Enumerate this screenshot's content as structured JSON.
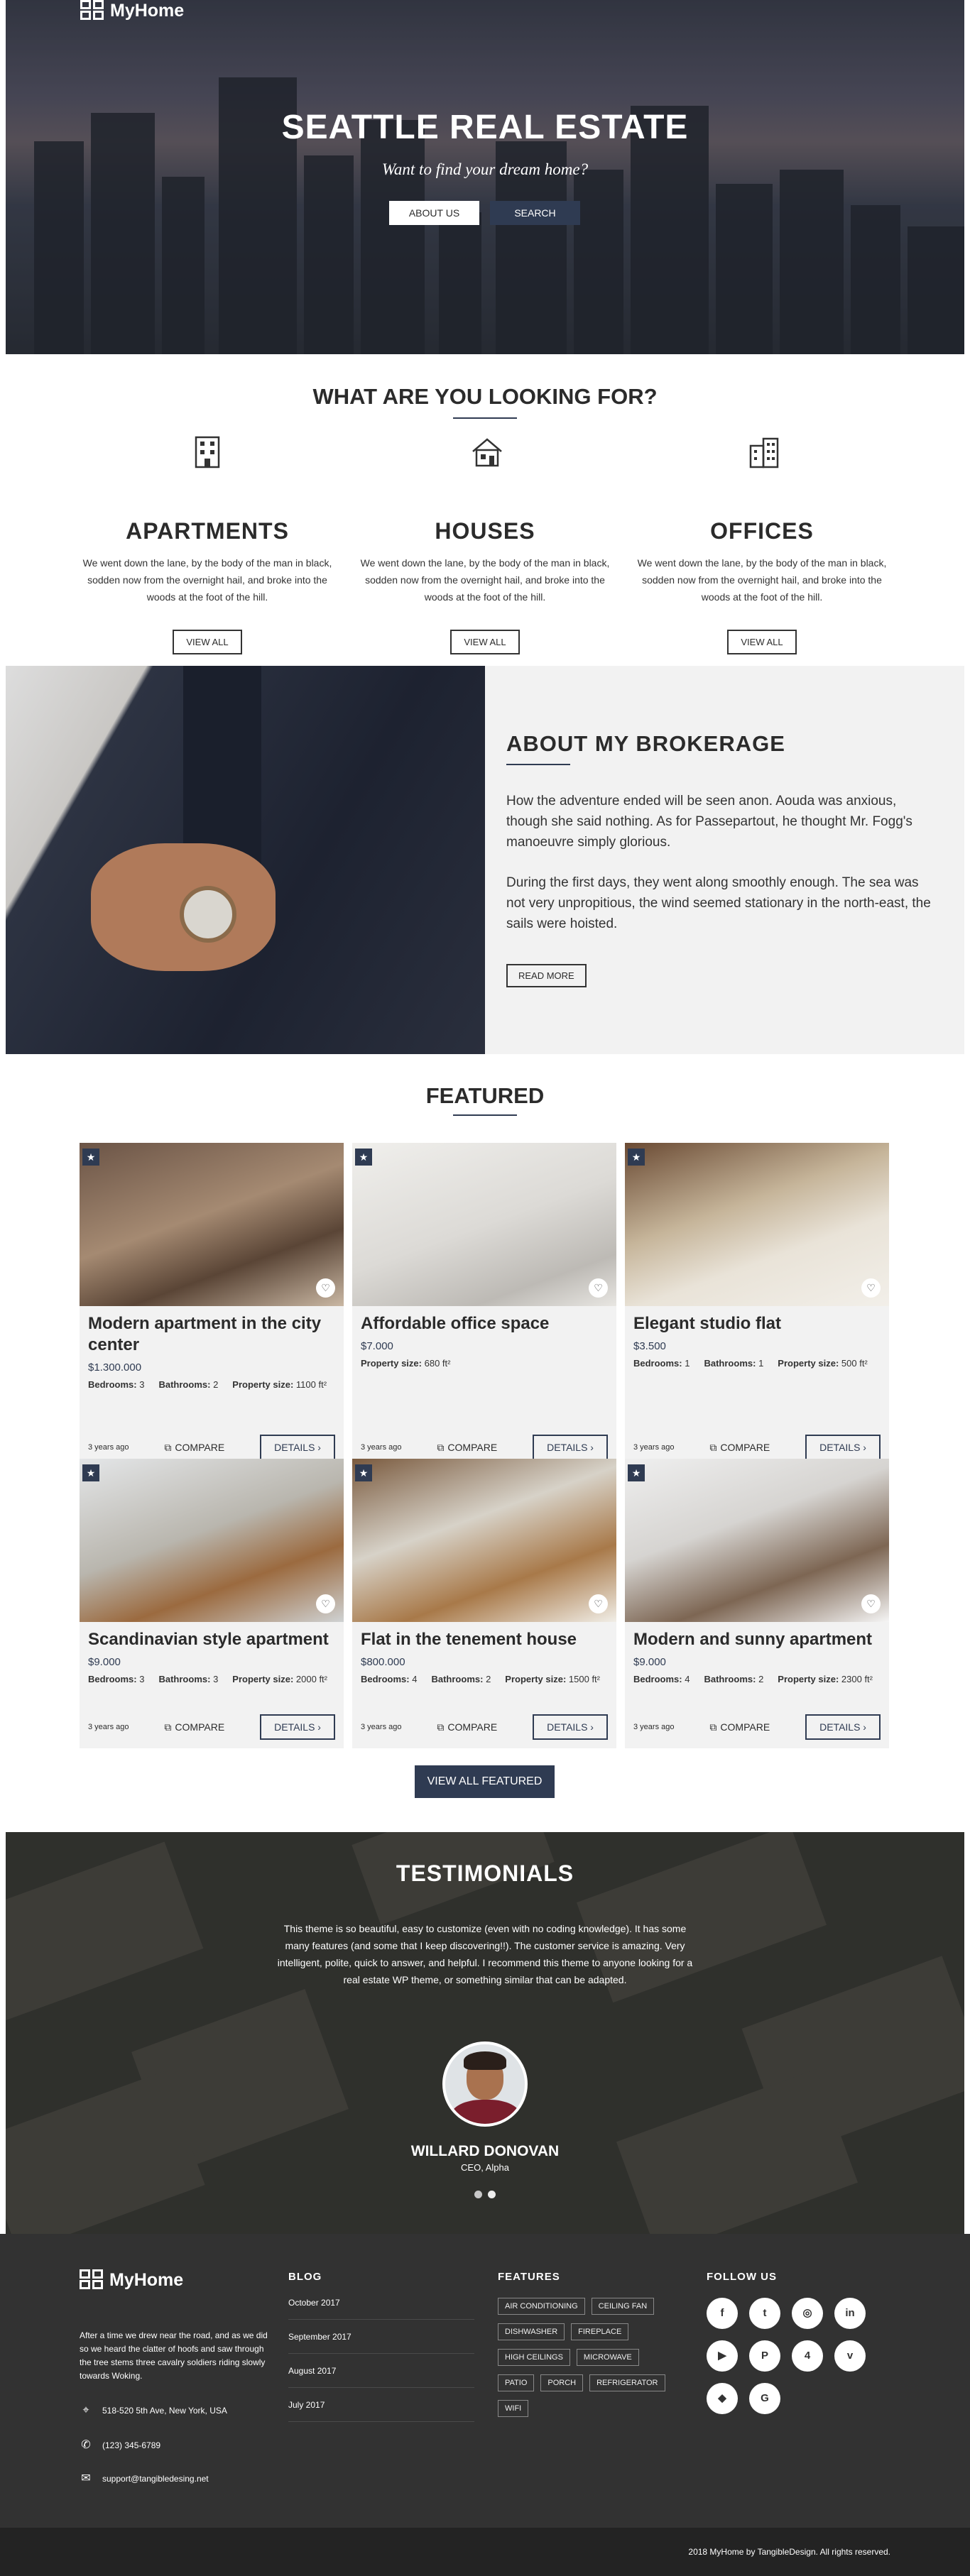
{
  "brand": {
    "name": "MyHome"
  },
  "hero": {
    "title": "SEATTLE REAL ESTATE",
    "subtitle": "Want to find your dream home?",
    "about_btn": "ABOUT US",
    "search_btn": "SEARCH"
  },
  "looking": {
    "title": "WHAT ARE YOU LOOKING FOR?",
    "columns": [
      {
        "title": "APARTMENTS",
        "text": "We went down the lane, by the body of the man in black, sodden now from the overnight hail, and broke into the woods at the foot of the hill.",
        "button": "VIEW ALL",
        "icon": "apartment-building-icon"
      },
      {
        "title": "HOUSES",
        "text": "We went down the lane, by the body of the man in black, sodden now from the overnight hail, and broke into the woods at the foot of the hill.",
        "button": "VIEW ALL",
        "icon": "house-icon"
      },
      {
        "title": "OFFICES",
        "text": "We went down the lane, by the body of the man in black, sodden now from the overnight hail, and broke into the woods at the foot of the hill.",
        "button": "VIEW ALL",
        "icon": "office-building-icon"
      }
    ]
  },
  "about": {
    "title": "ABOUT MY BROKERAGE",
    "p1": "How the adventure ended will be seen anon. Aouda was anxious, though she said nothing. As for Passepartout, he thought Mr. Fogg's manoeuvre simply glorious.",
    "p2": "During the first days, they went along smoothly enough. The sea was not very unpropitious, the wind seemed stationary in the north-east, the sails were hoisted.",
    "button": "READ MORE"
  },
  "featured": {
    "title": "FEATURED",
    "compare_label": "COMPARE",
    "details_label": "DETAILS ›",
    "view_all": "VIEW ALL FEATURED",
    "listings": [
      {
        "title": "Modern apartment in the city center",
        "price": "$1.300.000",
        "bed_label": "Bedrooms:",
        "bed": "3",
        "bath_label": "Bathrooms:",
        "bath": "2",
        "size_label": "Property size:",
        "size": "1100 ft²",
        "age": "3 years ago"
      },
      {
        "title": "Affordable office space",
        "price": "$7.000",
        "size_label": "Property size:",
        "size": "680 ft²",
        "age": "3 years ago"
      },
      {
        "title": "Elegant studio flat",
        "price": "$3.500",
        "bed_label": "Bedrooms:",
        "bed": "1",
        "bath_label": "Bathrooms:",
        "bath": "1",
        "size_label": "Property size:",
        "size": "500 ft²",
        "age": "3 years ago"
      },
      {
        "title": "Scandinavian style apartment",
        "price": "$9.000",
        "bed_label": "Bedrooms:",
        "bed": "3",
        "bath_label": "Bathrooms:",
        "bath": "3",
        "size_label": "Property size:",
        "size": "2000 ft²",
        "age": "3 years ago"
      },
      {
        "title": "Flat in the tenement house",
        "price": "$800.000",
        "bed_label": "Bedrooms:",
        "bed": "4",
        "bath_label": "Bathrooms:",
        "bath": "2",
        "size_label": "Property size:",
        "size": "1500 ft²",
        "age": "3 years ago"
      },
      {
        "title": "Modern and sunny apartment",
        "price": "$9.000",
        "bed_label": "Bedrooms:",
        "bed": "4",
        "bath_label": "Bathrooms:",
        "bath": "2",
        "size_label": "Property size:",
        "size": "2300 ft²",
        "age": "3 years ago"
      }
    ]
  },
  "testimonials": {
    "title": "TESTIMONIALS",
    "quote": "This theme is so beautiful, easy to customize (even with no coding knowledge). It has some many features (and some that I keep discovering!!). The customer service is amazing. Very intelligent, polite, quick to answer, and helpful. I recommend this theme to anyone looking for a real estate WP theme, or something similar that can be adapted.",
    "name": "WILLARD DONOVAN",
    "role": "CEO, Alpha"
  },
  "footer": {
    "about": "After a time we drew near the road, and as we did so we heard the clatter of hoofs and saw through the tree stems three cavalry soldiers riding slowly towards Woking.",
    "address": "518-520 5th Ave, New York, USA",
    "phone": "(123) 345-6789",
    "email": "support@tangibledesing.net",
    "blog_title": "BLOG",
    "blog": [
      "October 2017",
      "September 2017",
      "August 2017",
      "July 2017"
    ],
    "features_title": "FEATURES",
    "features": [
      "AIR CONDITIONING",
      "CEILING FAN",
      "DISHWASHER",
      "FIREPLACE",
      "HIGH CEILINGS",
      "MICROWAVE",
      "PATIO",
      "PORCH",
      "REFRIGERATOR",
      "WIFI"
    ],
    "follow_title": "FOLLOW US",
    "social": [
      "facebook-icon",
      "twitter-icon",
      "instagram-icon",
      "linkedin-icon",
      "youtube-icon",
      "pinterest-icon",
      "foursquare-icon",
      "vimeo-icon",
      "dropbox-icon",
      "google-icon"
    ],
    "copyright": "2018 MyHome by TangibleDesign. All rights reserved."
  },
  "colors": {
    "accent": "#2f3b52",
    "footer_bg": "#323232",
    "footer_bottom": "#232323",
    "card_bg": "#f2f2f2"
  }
}
